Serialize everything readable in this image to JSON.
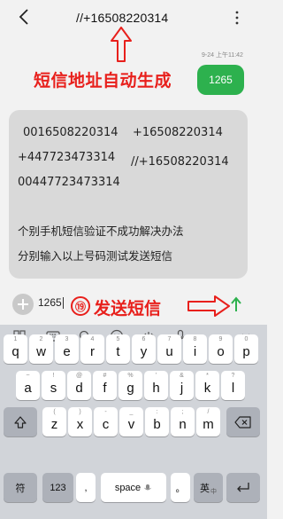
{
  "header": {
    "title": "//+16508220314"
  },
  "annotations": {
    "top_label": "短信地址自动生成",
    "bottom_label": "发送短信",
    "step_number": "⑲"
  },
  "sent_message": {
    "timestamp": "9-24 上午11:42",
    "text": "1265"
  },
  "received_message": {
    "numbers": [
      "0016508220314",
      "+16508220314",
      "+447723473314",
      "//+16508220314",
      "00447723473314"
    ],
    "note_line_1": "个别手机短信验证不成功解决办法",
    "note_line_2": "分别输入以上号码测试发送短信"
  },
  "compose": {
    "input_value": "1265"
  },
  "keyboard": {
    "toolbar_icons": [
      "keyboard-grid-icon",
      "dots-grid-icon",
      "search-icon",
      "emoji-icon",
      "cursor-move-icon",
      "microphone-icon",
      "collapse-icon"
    ],
    "row1": [
      {
        "sub": "1",
        "main": "q"
      },
      {
        "sub": "2",
        "main": "w"
      },
      {
        "sub": "3",
        "main": "e"
      },
      {
        "sub": "4",
        "main": "r"
      },
      {
        "sub": "5",
        "main": "t"
      },
      {
        "sub": "6",
        "main": "y"
      },
      {
        "sub": "7",
        "main": "u"
      },
      {
        "sub": "8",
        "main": "i"
      },
      {
        "sub": "9",
        "main": "o"
      },
      {
        "sub": "0",
        "main": "p"
      }
    ],
    "row2": [
      {
        "sub": "~",
        "main": "a"
      },
      {
        "sub": "!",
        "main": "s"
      },
      {
        "sub": "@",
        "main": "d"
      },
      {
        "sub": "#",
        "main": "f"
      },
      {
        "sub": "%",
        "main": "g"
      },
      {
        "sub": "'",
        "main": "h"
      },
      {
        "sub": "&",
        "main": "j"
      },
      {
        "sub": "*",
        "main": "k"
      },
      {
        "sub": "?",
        "main": "l"
      }
    ],
    "row3": [
      {
        "sub": "(",
        "main": "z"
      },
      {
        "sub": ")",
        "main": "x"
      },
      {
        "sub": "-",
        "main": "c"
      },
      {
        "sub": "_",
        "main": "v"
      },
      {
        "sub": ":",
        "main": "b"
      },
      {
        "sub": ";",
        "main": "n"
      },
      {
        "sub": "/",
        "main": "m"
      }
    ],
    "symbols_key": "符",
    "numbers_key": "123",
    "comma_key": ",",
    "space_key": "space",
    "period_key": "。",
    "lang_key": "英",
    "lang_sub": "中"
  },
  "colors": {
    "accent_green": "#2db14e",
    "annotation_red": "#e8201c"
  }
}
